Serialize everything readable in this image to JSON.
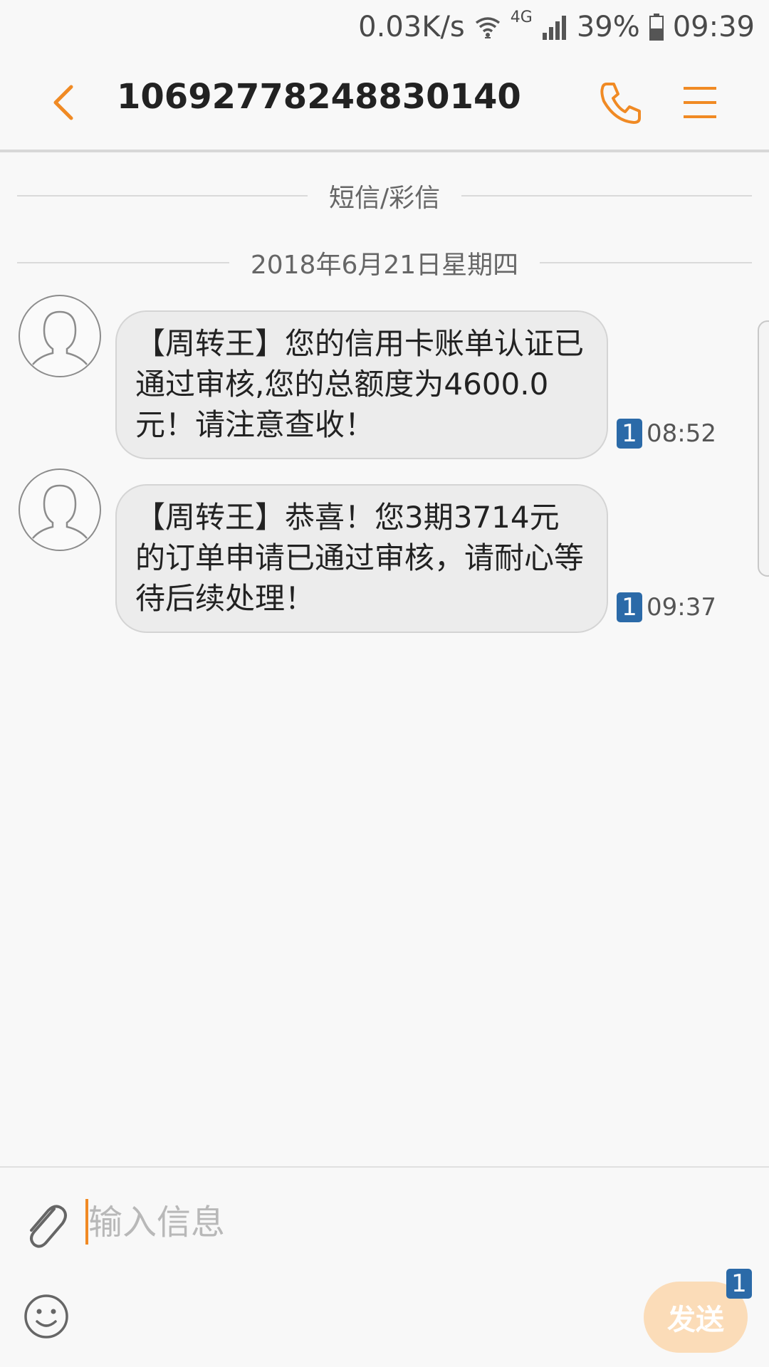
{
  "status_bar": {
    "net_speed": "0.03K/s",
    "network_type": "4G",
    "battery": "39%",
    "time": "09:39",
    "icons": [
      "wifi-icon",
      "signal-icon",
      "battery-icon"
    ]
  },
  "header": {
    "back_icon": "back-chevron-icon",
    "title": "10692778248830140",
    "call_icon": "phone-icon",
    "menu_icon": "menu-icon"
  },
  "thread": {
    "channel_label": "短信/彩信",
    "date_label": "2018年6月21日星期四",
    "messages": [
      {
        "text": "【周转王】您的信用卡账单认证已通过审核,您的总额度为4600.0元！请注意查收！",
        "sim": "1",
        "time": "08:52"
      },
      {
        "text": "【周转王】恭喜！您3期3714元的订单申请已通过审核，请耐心等待后续处理！",
        "sim": "1",
        "time": "09:37"
      }
    ]
  },
  "composer": {
    "attach_icon": "paperclip-icon",
    "placeholder": "输入信息",
    "emoji_icon": "emoji-icon",
    "send_label": "发送",
    "send_sim": "1"
  },
  "colors": {
    "accent": "#f08a24",
    "bubble": "#ececec",
    "sim_badge": "#2b6aa8",
    "send_button": "#fbdcb8"
  }
}
